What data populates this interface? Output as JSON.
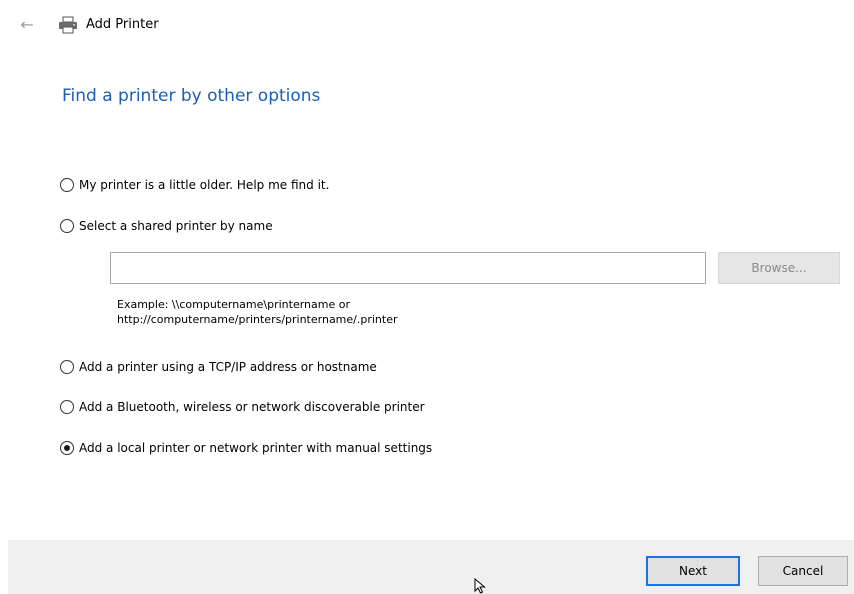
{
  "window": {
    "title": "Add Printer",
    "back_icon": "←"
  },
  "page": {
    "heading": "Find a printer by other options"
  },
  "options": [
    {
      "label": "My printer is a little older. Help me find it.",
      "checked": false
    },
    {
      "label": "Select a shared printer by name",
      "checked": false
    },
    {
      "label": "Add a printer using a TCP/IP address or hostname",
      "checked": false
    },
    {
      "label": "Add a Bluetooth, wireless or network discoverable printer",
      "checked": false
    },
    {
      "label": "Add a local printer or network printer with manual settings",
      "checked": true
    }
  ],
  "shared_printer": {
    "value": "",
    "browse_label": "Browse...",
    "example_line1": "Example: \\\\computername\\printername or",
    "example_line2": "http://computername/printers/printername/.printer"
  },
  "footer": {
    "next_label": "Next",
    "cancel_label": "Cancel"
  },
  "colors": {
    "heading": "#1a5fb4",
    "next_focus_border": "#1a73e8",
    "footer_bg": "#f0f0f0"
  },
  "icons": {
    "back": "arrow-left-icon",
    "printer": "printer-icon",
    "cursor": "mouse-pointer-icon"
  }
}
